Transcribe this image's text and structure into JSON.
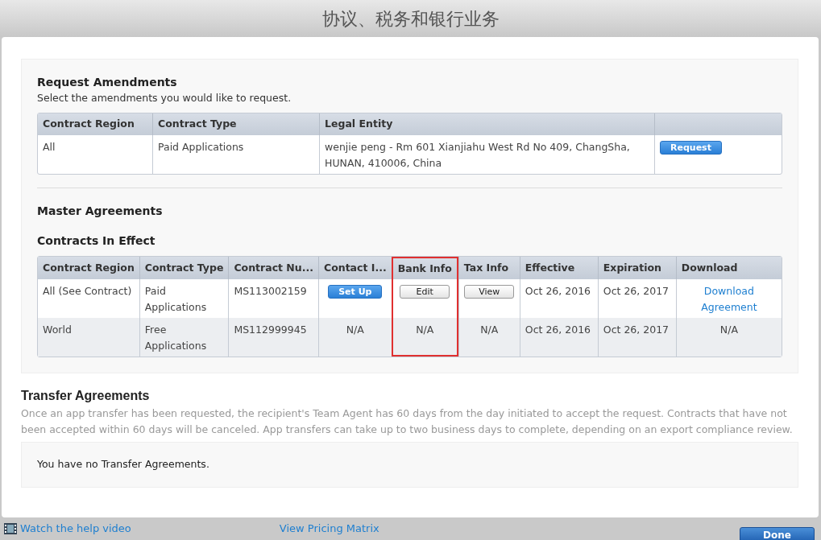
{
  "window": {
    "title": "协议、税务和银行业务"
  },
  "request_amendments": {
    "heading": "Request Amendments",
    "subtitle": "Select the amendments you would like to request.",
    "columns": [
      "Contract Region",
      "Contract Type",
      "Legal Entity"
    ],
    "rows": [
      {
        "region": "All",
        "type": "Paid Applications",
        "entity": "wenjie peng - Rm 601 Xianjiahu West Rd No 409, ChangSha, HUNAN, 410006, China",
        "button": "Request"
      }
    ]
  },
  "master_agreements": {
    "heading": "Master Agreements"
  },
  "contracts_in_effect": {
    "heading": "Contracts In Effect",
    "columns": [
      {
        "label": "Contract Region",
        "highlighted": false
      },
      {
        "label": "Contract Type",
        "highlighted": false
      },
      {
        "label": "Contract Nu...",
        "highlighted": false
      },
      {
        "label": "Contact I...",
        "highlighted": false
      },
      {
        "label": "Bank Info",
        "highlighted": true
      },
      {
        "label": "Tax Info",
        "highlighted": false
      },
      {
        "label": "Effective",
        "highlighted": false
      },
      {
        "label": "Expiration",
        "highlighted": false
      },
      {
        "label": "Download",
        "highlighted": false
      }
    ],
    "rows": [
      {
        "cells": [
          {
            "kind": "text",
            "text": "All (See Contract)"
          },
          {
            "kind": "text",
            "text": "Paid Applications"
          },
          {
            "kind": "text",
            "text": "MS113002159"
          },
          {
            "kind": "primary_button",
            "text": "Set Up"
          },
          {
            "kind": "button",
            "text": "Edit"
          },
          {
            "kind": "button",
            "text": "View"
          },
          {
            "kind": "text",
            "text": "Oct 26, 2016"
          },
          {
            "kind": "text",
            "text": "Oct 26, 2017"
          },
          {
            "kind": "link",
            "text": "Download Agreement"
          }
        ]
      },
      {
        "cells": [
          {
            "kind": "text",
            "text": "World"
          },
          {
            "kind": "text",
            "text": "Free Applications"
          },
          {
            "kind": "text",
            "text": "MS112999945"
          },
          {
            "kind": "center",
            "text": "N/A"
          },
          {
            "kind": "center",
            "text": "N/A"
          },
          {
            "kind": "center",
            "text": "N/A"
          },
          {
            "kind": "text",
            "text": "Oct 26, 2016"
          },
          {
            "kind": "text",
            "text": "Oct 26, 2017"
          },
          {
            "kind": "center",
            "text": "N/A"
          }
        ]
      }
    ]
  },
  "transfer_agreements": {
    "heading": "Transfer Agreements",
    "note": "Once an app transfer has been requested, the recipient's Team Agent has 60 days from the day initiated to accept the request. Contracts that have not been accepted within 60 days will be canceled. App transfers can take up to two business days to complete, depending on an export compliance review.",
    "empty_message": "You have no Transfer Agreements."
  },
  "footer": {
    "help_link": "Watch the help video",
    "pricing_link": "View Pricing Matrix",
    "done_button": "Done"
  }
}
